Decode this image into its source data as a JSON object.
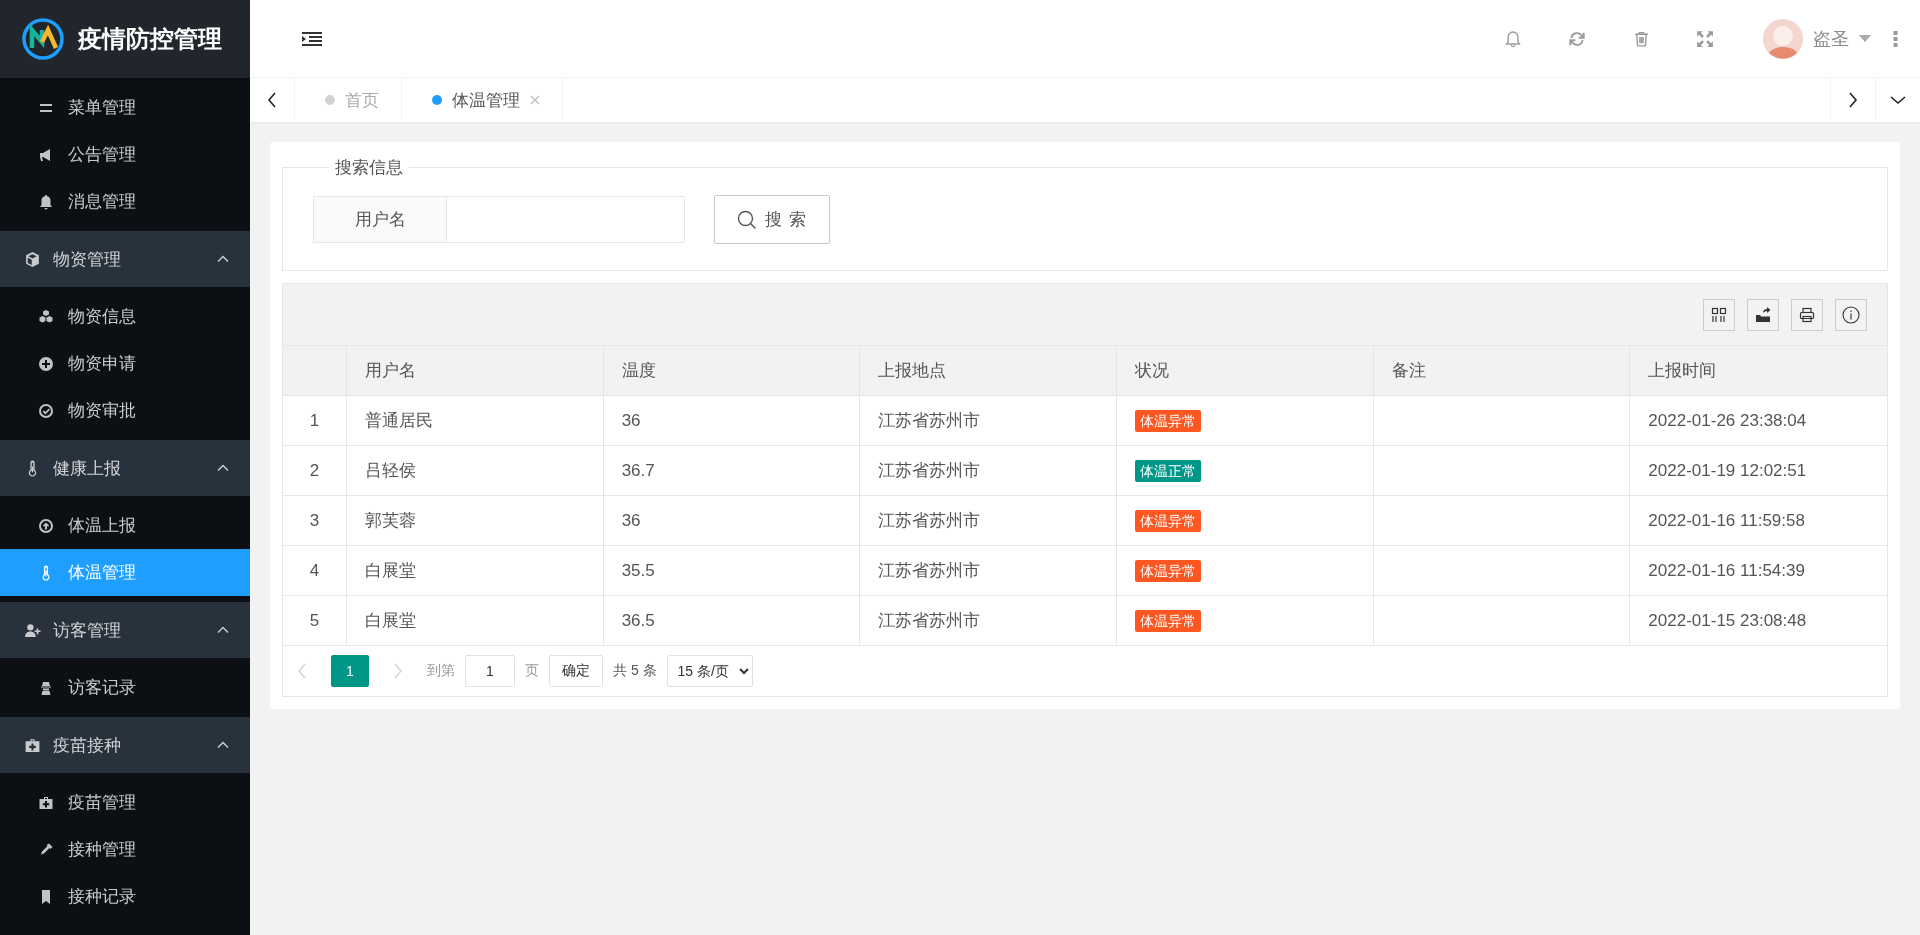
{
  "app": {
    "title": "疫情防控管理"
  },
  "header": {
    "user": "盗圣"
  },
  "sidebar": {
    "sections": [
      {
        "items": [
          {
            "label": "菜单管理",
            "selected": false
          },
          {
            "label": "公告管理",
            "selected": false
          },
          {
            "label": "消息管理",
            "selected": false
          }
        ]
      },
      {
        "title": "物资管理",
        "expanded": true,
        "items": [
          {
            "label": "物资信息",
            "selected": false
          },
          {
            "label": "物资申请",
            "selected": false
          },
          {
            "label": "物资审批",
            "selected": false
          }
        ]
      },
      {
        "title": "健康上报",
        "expanded": true,
        "items": [
          {
            "label": "体温上报",
            "selected": false
          },
          {
            "label": "体温管理",
            "selected": true
          }
        ]
      },
      {
        "title": "访客管理",
        "expanded": true,
        "items": [
          {
            "label": "访客记录",
            "selected": false
          }
        ]
      },
      {
        "title": "疫苗接种",
        "expanded": true,
        "items": [
          {
            "label": "疫苗管理",
            "selected": false
          },
          {
            "label": "接种管理",
            "selected": false
          },
          {
            "label": "接种记录",
            "selected": false
          }
        ]
      }
    ]
  },
  "tabs": [
    {
      "label": "首页",
      "selected": false,
      "closable": false
    },
    {
      "label": "体温管理",
      "selected": true,
      "closable": true
    }
  ],
  "search": {
    "legend": "搜索信息",
    "field_label": "用户名",
    "button": "搜 索"
  },
  "table": {
    "columns": [
      "用户名",
      "温度",
      "上报地点",
      "状况",
      "备注",
      "上报时间"
    ],
    "rows": [
      {
        "number": "1",
        "username": "普通居民",
        "temperature": "36",
        "location": "江苏省苏州市",
        "status": {
          "text": "体温异常",
          "color": "#ff5722"
        },
        "time": "2022-01-26 23:38:04"
      },
      {
        "number": "2",
        "username": "吕轻侯",
        "temperature": "36.7",
        "location": "江苏省苏州市",
        "status": {
          "text": "体温正常",
          "color": "#009688"
        },
        "time": "2022-01-19 12:02:51"
      },
      {
        "number": "3",
        "username": "郭芙蓉",
        "temperature": "36",
        "location": "江苏省苏州市",
        "status": {
          "text": "体温异常",
          "color": "#ff5722"
        },
        "time": "2022-01-16 11:59:58"
      },
      {
        "number": "4",
        "username": "白展堂",
        "temperature": "35.5",
        "location": "江苏省苏州市",
        "status": {
          "text": "体温异常",
          "color": "#ff5722"
        },
        "time": "2022-01-16 11:54:39"
      },
      {
        "number": "5",
        "username": "白展堂",
        "temperature": "36.5",
        "location": "江苏省苏州市",
        "status": {
          "text": "体温异常",
          "color": "#ff5722"
        },
        "time": "2022-01-15 23:08:48"
      }
    ]
  },
  "pagination": {
    "pages": [
      {
        "label": "1",
        "selected": true
      }
    ],
    "goto_label": "到第",
    "page_input": "1",
    "page_unit": "页",
    "confirm": "确定",
    "total": "共 5 条",
    "page_size": "15 条/页"
  }
}
